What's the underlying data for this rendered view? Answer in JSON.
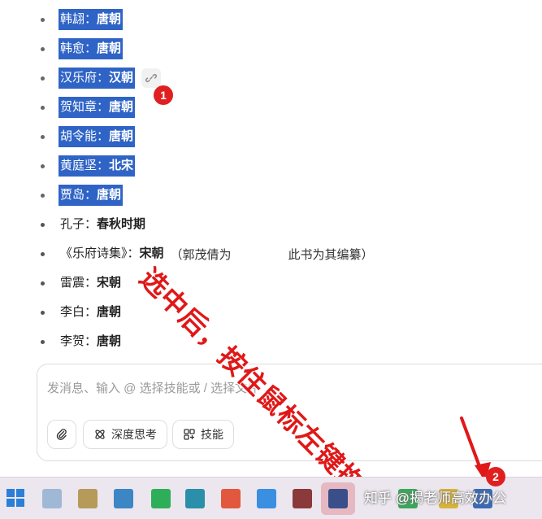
{
  "list_items": [
    {
      "name": "韩翃：",
      "dynasty": "唐朝",
      "selected": true
    },
    {
      "name": "韩愈：",
      "dynasty": "唐朝",
      "selected": true
    },
    {
      "name": "汉乐府：",
      "dynasty": "汉朝",
      "selected": true
    },
    {
      "name": "贺知章：",
      "dynasty": "唐朝",
      "selected": true
    },
    {
      "name": "胡令能：",
      "dynasty": "唐朝",
      "selected": true
    },
    {
      "name": "黄庭坚：",
      "dynasty": "北宋",
      "selected": true
    },
    {
      "name": "贾岛：",
      "dynasty": "唐朝",
      "selected": true
    },
    {
      "name": "孔子：",
      "dynasty": "春秋时期",
      "selected": false
    },
    {
      "name": "《乐府诗集》：",
      "dynasty": "宋朝",
      "note_left": "（郭茂倩为",
      "note_right": "此书为其编纂）",
      "selected": false
    },
    {
      "name": "雷震：",
      "dynasty": "宋朝",
      "selected": false
    },
    {
      "name": "李白：",
      "dynasty": "唐朝",
      "selected": false
    },
    {
      "name": "李贺：",
      "dynasty": "唐朝",
      "selected": false
    }
  ],
  "markers": {
    "one": "1",
    "two": "2"
  },
  "overlay_text": "选中后，按住鼠标左键拖动到",
  "chat": {
    "placeholder": "发消息、输入 @ 选择技能或 / 选择文件",
    "deep_think": "深度思考",
    "skills": "技能"
  },
  "watermark": "知乎 @揭老师高效办公",
  "colors": {
    "selection": "#2f64c6",
    "accent_red": "#e01818",
    "taskbar": "#ece6ef"
  },
  "icons": {
    "link": "link-icon",
    "attach": "paperclip-icon",
    "think": "atom-icon",
    "skills": "grid-icon",
    "start": "windows-start-icon"
  }
}
